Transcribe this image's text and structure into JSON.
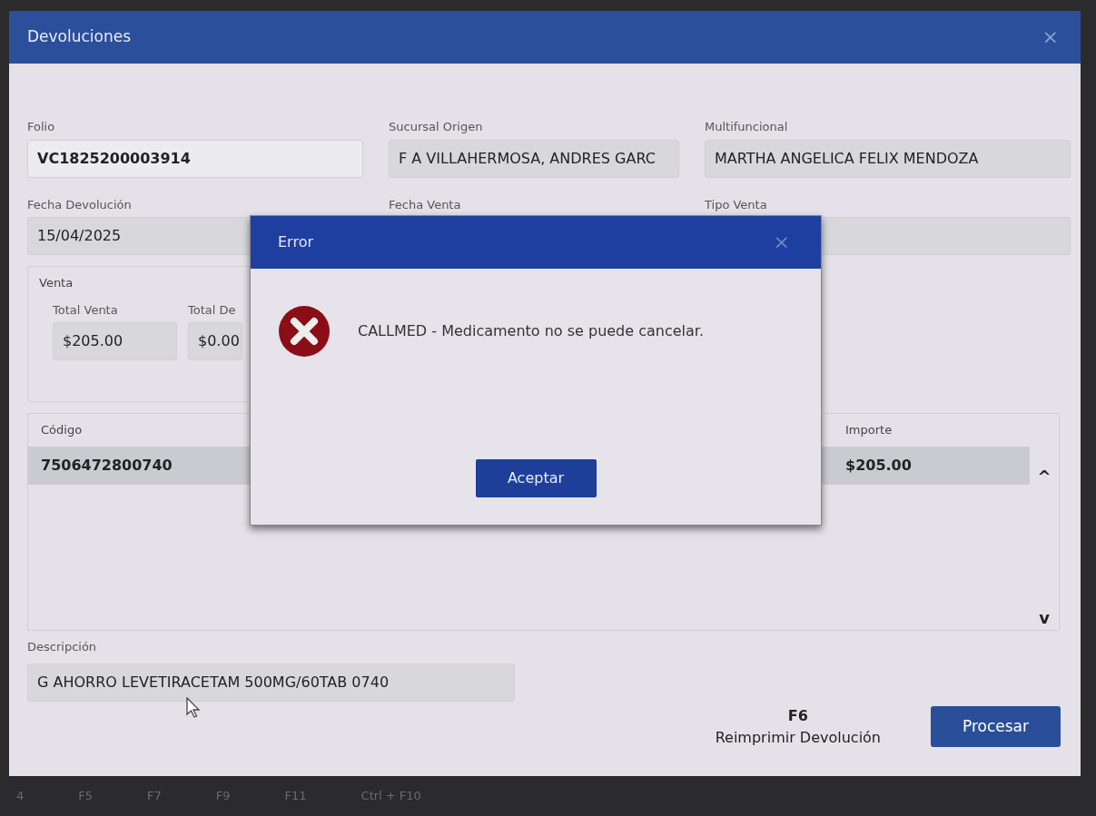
{
  "window": {
    "title": "Devoluciones",
    "close": "×"
  },
  "fields": [
    {
      "label": "Folio",
      "value": "VC1825200003914",
      "bold": true,
      "readonly": false
    },
    {
      "label": "Sucursal Origen",
      "value": "F A VILLAHERMOSA, ANDRES GARC",
      "bold": false,
      "readonly": true
    },
    {
      "label": "Multifuncional",
      "value": "MARTHA ANGELICA FELIX MENDOZA",
      "bold": false,
      "readonly": true
    },
    {
      "label": "Fecha Devolución",
      "value": "15/04/2025",
      "bold": false,
      "readonly": true
    },
    {
      "label": "Fecha Venta"
    },
    {
      "label": "Tipo Venta",
      "bold": false,
      "readonly": true
    }
  ],
  "venta": {
    "title": "Venta",
    "fields": [
      {
        "label": "Total Venta",
        "value": "$205.00"
      },
      {
        "label": "Total De",
        "value": "$0.00"
      }
    ]
  },
  "table": {
    "columns": [
      "Código",
      "Importe"
    ],
    "rows": [
      {
        "cells": [
          "7506472800740",
          "$205.00"
        ],
        "selected": true
      }
    ],
    "scroll_up": "^",
    "scroll_down": "v"
  },
  "descripcion": {
    "label": "Descripción",
    "value": "G AHORRO LEVETIRACETAM 500MG/60TAB 0740"
  },
  "reprint": {
    "key": "F6",
    "label": "Reimprimir Devolución"
  },
  "process_button": "Procesar",
  "dialog": {
    "title": "Error",
    "close": "×",
    "message": "CALLMED - Medicamento no se puede cancelar.",
    "button": "Aceptar"
  },
  "function_keys": [
    "4",
    "F5",
    "F7",
    "F9",
    "F11",
    "Ctrl + F10"
  ]
}
